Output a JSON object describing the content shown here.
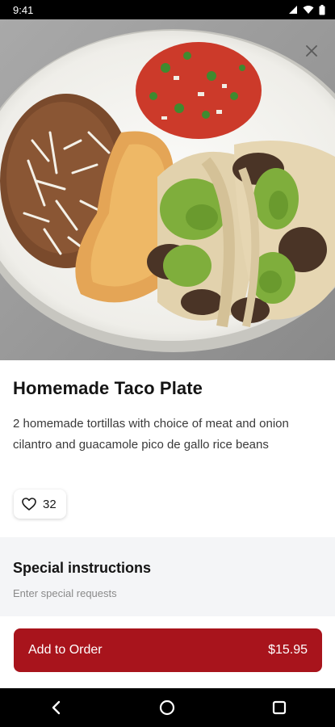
{
  "status_bar": {
    "time": "9:41"
  },
  "item": {
    "title": "Homemade Taco Plate",
    "description": "2 homemade tortillas with choice of meat and onion cilantro and guacamole pico de gallo rice beans",
    "likes": "32"
  },
  "special_instructions": {
    "title": "Special instructions",
    "placeholder": "Enter special requests"
  },
  "order_button": {
    "label": "Add to Order",
    "price": "$15.95"
  },
  "colors": {
    "accent": "#a8141c",
    "section_background": "#f4f5f7"
  },
  "icons": {
    "close": "close-icon",
    "like": "heart-icon",
    "nav_back": "back-icon",
    "nav_home": "home-icon",
    "nav_recents": "recents-icon"
  }
}
